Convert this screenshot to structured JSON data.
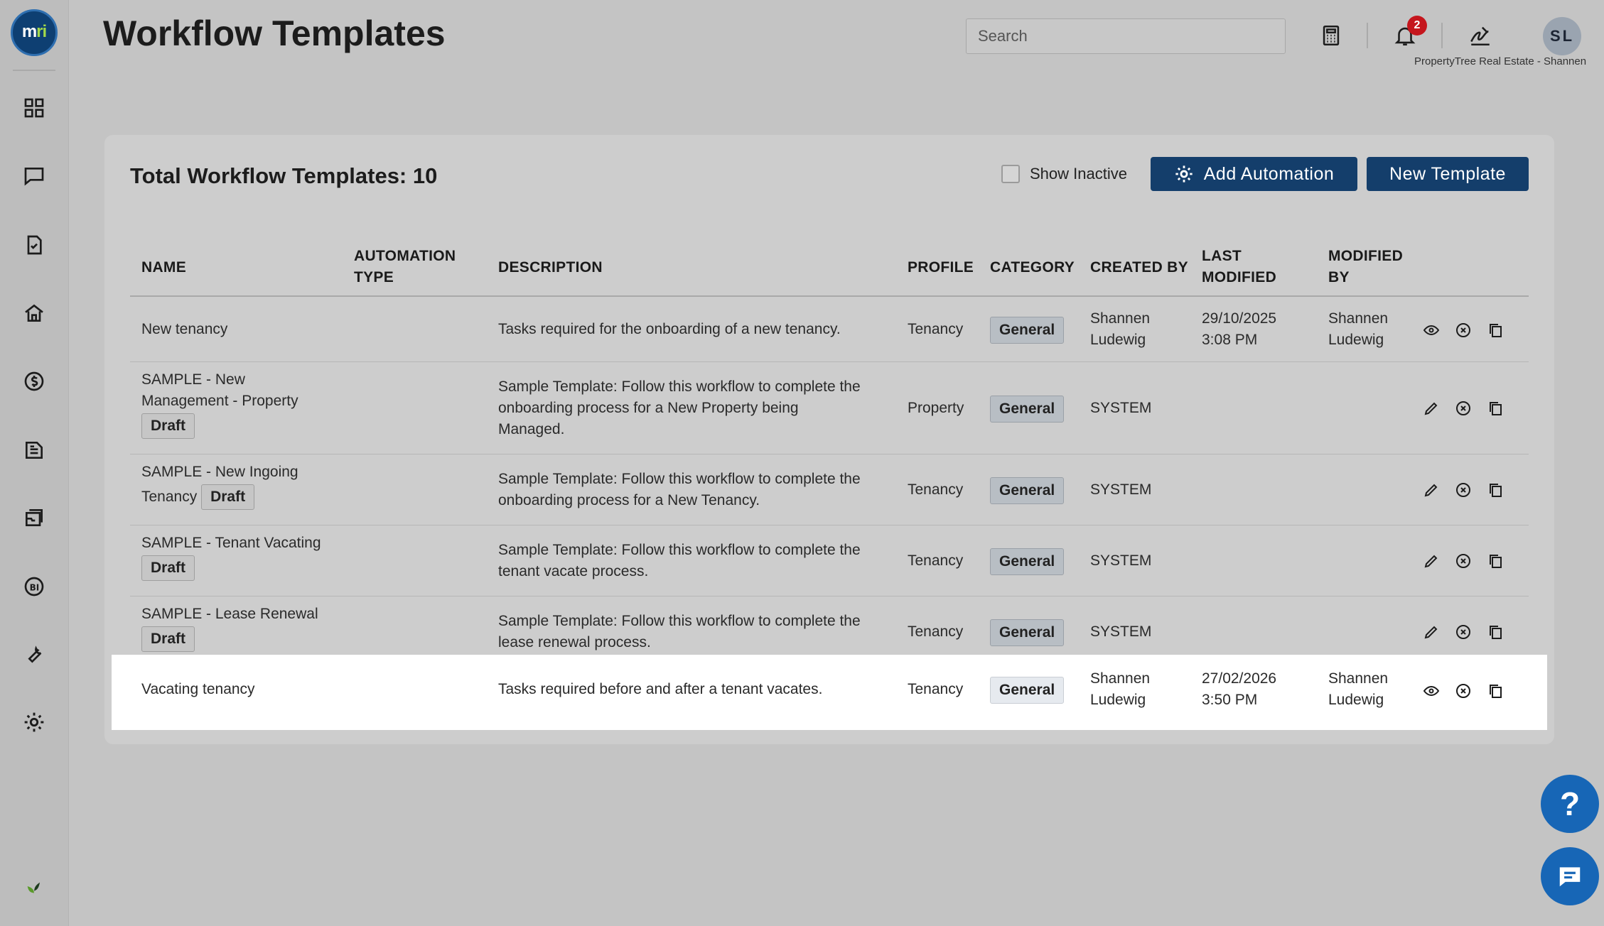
{
  "app": {
    "title": "Workflow Templates",
    "logo_text_main": "m",
    "logo_text_accent": "ri"
  },
  "header": {
    "search_placeholder": "Search",
    "notification_count": "2",
    "avatar_initials": "SL",
    "company": "PropertyTree Real Estate - Shannen"
  },
  "sidebar": {
    "icons": [
      "dashboard-icon",
      "chat-icon",
      "task-icon",
      "property-icon",
      "money-icon",
      "document-icon",
      "inbox-icon",
      "bi-icon",
      "tools-icon",
      "settings-icon",
      "plant-icon"
    ]
  },
  "card": {
    "title": "Total Workflow Templates: 10",
    "show_inactive_label": "Show Inactive",
    "add_automation_label": "Add Automation",
    "new_template_label": "New Template"
  },
  "table": {
    "headers": {
      "name": "NAME",
      "automation_type_1": "AUTOMATION",
      "automation_type_2": "TYPE",
      "description": "DESCRIPTION",
      "profile": "PROFILE",
      "category": "CATEGORY",
      "created_by": "CREATED BY",
      "last_modified_1": "LAST",
      "last_modified_2": "MODIFIED",
      "modified_by_1": "MODIFIED",
      "modified_by_2": "BY"
    },
    "rows": [
      {
        "name_1": "New tenancy",
        "name_2": "",
        "draft": "",
        "desc_1": "Tasks required for the onboarding of a new tenancy.",
        "desc_2": "",
        "desc_3": "",
        "profile": "Tenancy",
        "category": "General",
        "created_1": "Shannen",
        "created_2": "Ludewig",
        "modified_1": "29/10/2025",
        "modified_2": "3:08 PM",
        "modby_1": "Shannen",
        "modby_2": "Ludewig",
        "primary_action": "view-icon"
      },
      {
        "name_1": "SAMPLE - New",
        "name_2": "Management - Property",
        "draft": "Draft",
        "desc_1": "Sample Template: Follow this workflow to complete the",
        "desc_2": "onboarding process for a New Property being",
        "desc_3": "Managed.",
        "profile": "Property",
        "category": "General",
        "created_1": "SYSTEM",
        "created_2": "",
        "modified_1": "",
        "modified_2": "",
        "modby_1": "",
        "modby_2": "",
        "primary_action": "edit-icon"
      },
      {
        "name_1": "SAMPLE - New Ingoing",
        "name_2": "Tenancy",
        "draft": "Draft",
        "desc_1": "Sample Template: Follow this workflow to complete the",
        "desc_2": "onboarding process for a New Tenancy.",
        "desc_3": "",
        "profile": "Tenancy",
        "category": "General",
        "created_1": "SYSTEM",
        "created_2": "",
        "modified_1": "",
        "modified_2": "",
        "modby_1": "",
        "modby_2": "",
        "primary_action": "edit-icon"
      },
      {
        "name_1": "SAMPLE - Tenant Vacating",
        "name_2": "",
        "draft": "Draft",
        "desc_1": "Sample Template: Follow this workflow to complete the",
        "desc_2": "tenant vacate process.",
        "desc_3": "",
        "profile": "Tenancy",
        "category": "General",
        "created_1": "SYSTEM",
        "created_2": "",
        "modified_1": "",
        "modified_2": "",
        "modby_1": "",
        "modby_2": "",
        "primary_action": "edit-icon"
      },
      {
        "name_1": "SAMPLE - Lease Renewal",
        "name_2": "",
        "draft": "Draft",
        "desc_1": "Sample Template: Follow this workflow to complete the",
        "desc_2": "lease renewal process.",
        "desc_3": "",
        "profile": "Tenancy",
        "category": "General",
        "created_1": "SYSTEM",
        "created_2": "",
        "modified_1": "",
        "modified_2": "",
        "modby_1": "",
        "modby_2": "",
        "primary_action": "edit-icon"
      },
      {
        "name_1": "Vacating tenancy",
        "name_2": "",
        "draft": "",
        "desc_1": "Tasks required before and after a tenant vacates.",
        "desc_2": "",
        "desc_3": "",
        "profile": "Tenancy",
        "category": "General",
        "created_1": "Shannen",
        "created_2": "Ludewig",
        "modified_1": "27/02/2026",
        "modified_2": "3:50 PM",
        "modby_1": "Shannen",
        "modby_2": "Ludewig",
        "primary_action": "view-icon"
      }
    ]
  },
  "floating": {
    "help_label": "?"
  }
}
